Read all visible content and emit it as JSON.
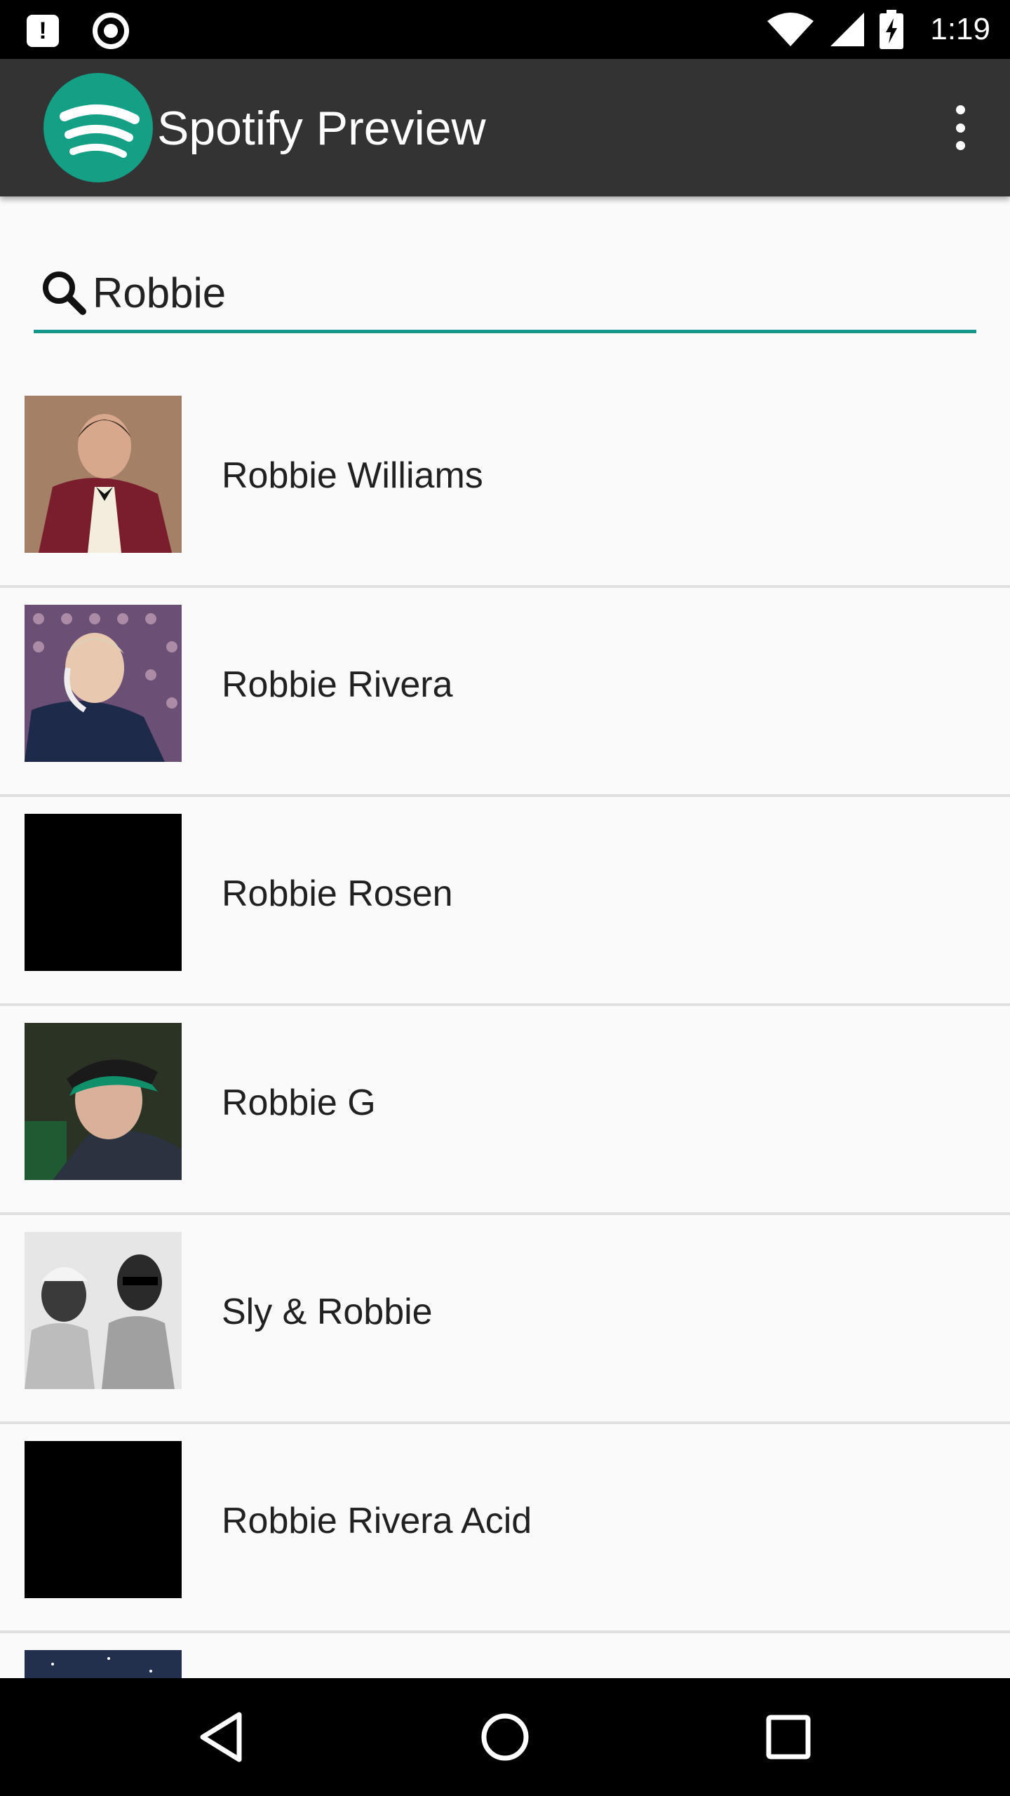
{
  "status_bar": {
    "time": "1:19",
    "icons": [
      "alert-icon",
      "record-icon",
      "wifi-icon",
      "signal-icon",
      "battery-charging-icon"
    ]
  },
  "app_bar": {
    "title": "Spotify Preview",
    "logo": "spotify-logo-icon",
    "menu_icon": "more-vert-icon"
  },
  "search": {
    "value": "Robbie",
    "icon": "search-icon",
    "accent_color": "#16978b"
  },
  "results": [
    {
      "name": "Robbie Williams"
    },
    {
      "name": "Robbie Rivera"
    },
    {
      "name": "Robbie Rosen"
    },
    {
      "name": "Robbie G"
    },
    {
      "name": "Sly & Robbie"
    },
    {
      "name": "Robbie Rivera Acid"
    }
  ],
  "nav_bar": {
    "back": "back-icon",
    "home": "home-icon",
    "recents": "recents-icon"
  },
  "colors": {
    "app_bar": "#333333",
    "logo": "#14a085",
    "background": "#fafafa"
  }
}
